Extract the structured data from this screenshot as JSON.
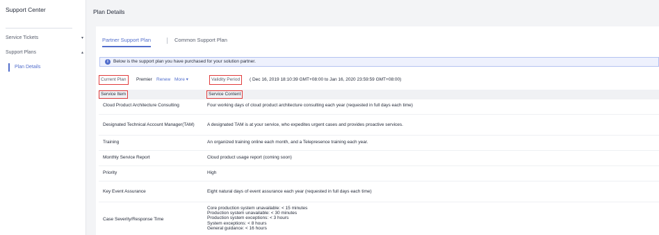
{
  "sidebar": {
    "title": "Support Center",
    "items": [
      {
        "label": "Service Tickets",
        "caret": "▾"
      },
      {
        "label": "Support Plans",
        "caret": "▴"
      }
    ],
    "sub_item": "Plan Details"
  },
  "header": {
    "title": "Plan Details"
  },
  "tabs": [
    {
      "label": "Partner Support Plan",
      "active": true
    },
    {
      "label": "Common Support Plan",
      "active": false
    }
  ],
  "info": {
    "icon": "info-icon",
    "text": "Below is the support plan you have purchased for your solution partner."
  },
  "plan": {
    "current_label": "Current Plan",
    "current_value": "Premier",
    "renew_label": "Renew",
    "more_label": "More ▾",
    "validity_label": "Validity Period",
    "validity_value": "( Dec 16, 2019 18:10:39 GMT+08:00 to Jan 16, 2020 23:59:59 GMT+08:00)"
  },
  "table": {
    "headers": [
      "Service Item",
      "Service Content"
    ],
    "rows": [
      {
        "item": "Cloud Product Architecture Consulting",
        "content": [
          "Four working days of cloud product architecture consulting each year (requested in full days each time)"
        ]
      },
      {
        "item": "Designated Technical Account Manager(TAM)",
        "content": [
          "A designated TAM is at your service, who expedites urgent cases and provides proactive services."
        ]
      },
      {
        "item": "Training",
        "content": [
          "An organized training online each month, and a Telepresence training each year."
        ]
      },
      {
        "item": "Monthly Service Report",
        "content": [
          "Cloud product usage report (coming soon)"
        ]
      },
      {
        "item": "Priority",
        "content": [
          "High"
        ]
      },
      {
        "item": "Key Event Assurance",
        "content": [
          "Eight natural days of event assurance each year (requested in full days each time)"
        ]
      },
      {
        "item": "Case Severity/Response Time",
        "content": [
          "Core production system unavailable: < 15 minutes",
          "Production system unavailable: < 30 minutes",
          "Production system exceptions: < 3 hours",
          "System exceptions: < 8 hours",
          "General guidance: < 16 hours"
        ]
      }
    ]
  },
  "colors": {
    "accent": "#526ecc",
    "highlight_box": "#e03a3a",
    "info_bg": "#eef1fd"
  }
}
